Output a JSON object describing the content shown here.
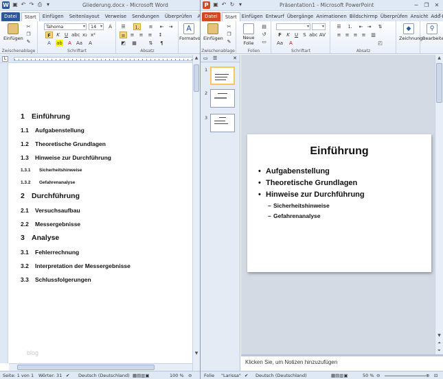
{
  "word": {
    "title": "Gliederung.docx - Microsoft Word",
    "tabs": [
      "Datei",
      "Start",
      "Einfügen",
      "Seitenlayout",
      "Verweise",
      "Sendungen",
      "Überprüfen",
      "Ansicht"
    ],
    "active_tab": "Start",
    "font_name": "Tahoma",
    "font_size": "14",
    "groups": [
      "Zwischenablage",
      "Schriftart",
      "Absatz"
    ],
    "paste_label": "Einfügen",
    "format_label": "Formatvo",
    "outline": [
      {
        "num": "1",
        "text": "Einführung",
        "level": 1
      },
      {
        "num": "1.1",
        "text": "Aufgabenstellung",
        "level": 2
      },
      {
        "num": "1.2",
        "text": "Theoretische Grundlagen",
        "level": 2
      },
      {
        "num": "1.3",
        "text": "Hinweise zur Durchführung",
        "level": 2
      },
      {
        "num": "1.3.1",
        "text": "Sicherheitshinweise",
        "level": 3
      },
      {
        "num": "1.3.2",
        "text": "Gefahrenanalyse",
        "level": 3
      },
      {
        "num": "2",
        "text": "Durchführung",
        "level": 1
      },
      {
        "num": "2.1",
        "text": "Versuchsaufbau",
        "level": 2
      },
      {
        "num": "2.2",
        "text": "Messergebnisse",
        "level": 2
      },
      {
        "num": "3",
        "text": "Analyse",
        "level": 1
      },
      {
        "num": "3.1",
        "text": "Fehlerrechnung",
        "level": 2
      },
      {
        "num": "3.2",
        "text": "Interpretation der Messergebnisse",
        "level": 2
      },
      {
        "num": "3.3",
        "text": "Schlussfolgerungen",
        "level": 2
      }
    ],
    "watermark": "blog",
    "status": {
      "page": "Seite: 1 von 1",
      "words": "Wörter: 31",
      "language": "Deutsch (Deutschland)",
      "zoom": "100 %"
    }
  },
  "ppt": {
    "title": "Präsentation1 - Microsoft PowerPoint",
    "tabs": [
      "Datei",
      "Start",
      "Einfügen",
      "Entwurf",
      "Übergänge",
      "Animationen",
      "Bildschirmp",
      "Überprüfen",
      "Ansicht",
      "Add-Ins"
    ],
    "active_tab": "Start",
    "groups": [
      "Zwischenablage",
      "Folien",
      "Schriftart",
      "Absatz"
    ],
    "paste_label": "Einfügen",
    "new_slide_label_1": "Neue",
    "new_slide_label_2": "Folie",
    "drawing_label": "Zeichnung",
    "edit_label": "Bearbeiten",
    "thumbnail_numbers": [
      "1",
      "2",
      "3"
    ],
    "slide": {
      "title": "Einführung",
      "bullets": [
        {
          "text": "Aufgabenstellung",
          "level": 1,
          "marker": "•"
        },
        {
          "text": "Theoretische Grundlagen",
          "level": 1,
          "marker": "•"
        },
        {
          "text": "Hinweise zur Durchführung",
          "level": 1,
          "marker": "•"
        },
        {
          "text": "Sicherheitshinweise",
          "level": 2,
          "marker": "–"
        },
        {
          "text": "Gefahrenanalyse",
          "level": 2,
          "marker": "–"
        }
      ]
    },
    "notes_placeholder": "Klicken Sie, um Notizen hinzuzufügen",
    "status": {
      "slide": "Folie",
      "theme": "\"Larissa\"",
      "language": "Deutsch (Deutschland)",
      "zoom": "50 %"
    }
  },
  "colors": {
    "word_brand": "#2b5797",
    "ppt_brand": "#d24726",
    "chrome": "#dfe8f5",
    "selection": "#f5c85c"
  }
}
